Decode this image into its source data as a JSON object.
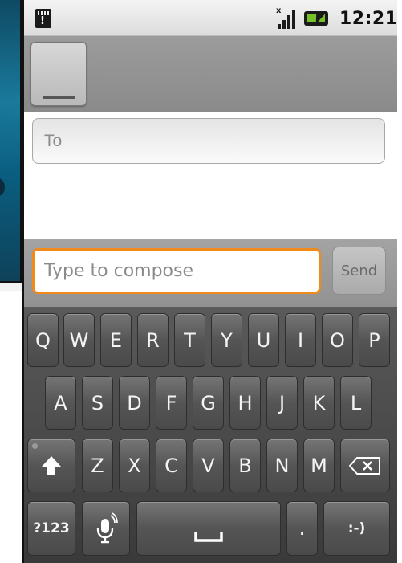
{
  "status_bar": {
    "time": "12:21"
  },
  "header": {
    "avatar_icon": "contact-photo-icon"
  },
  "to_field": {
    "placeholder": "To"
  },
  "compose": {
    "placeholder": "Type to compose",
    "send_label": "Send",
    "focus_color": "#f08a1a"
  },
  "keyboard": {
    "row1": [
      "Q",
      "W",
      "E",
      "R",
      "T",
      "Y",
      "U",
      "I",
      "O",
      "P"
    ],
    "row2": [
      "A",
      "S",
      "D",
      "F",
      "G",
      "H",
      "J",
      "K",
      "L"
    ],
    "row3": [
      "Z",
      "X",
      "C",
      "V",
      "B",
      "N",
      "M"
    ],
    "symbols_label": "?123",
    "period_label": ".",
    "smiley_label": ":-)",
    "icons": {
      "shift": "shift-arrow-icon",
      "delete": "backspace-icon",
      "mic": "microphone-icon",
      "space": "space-bar-icon"
    }
  }
}
